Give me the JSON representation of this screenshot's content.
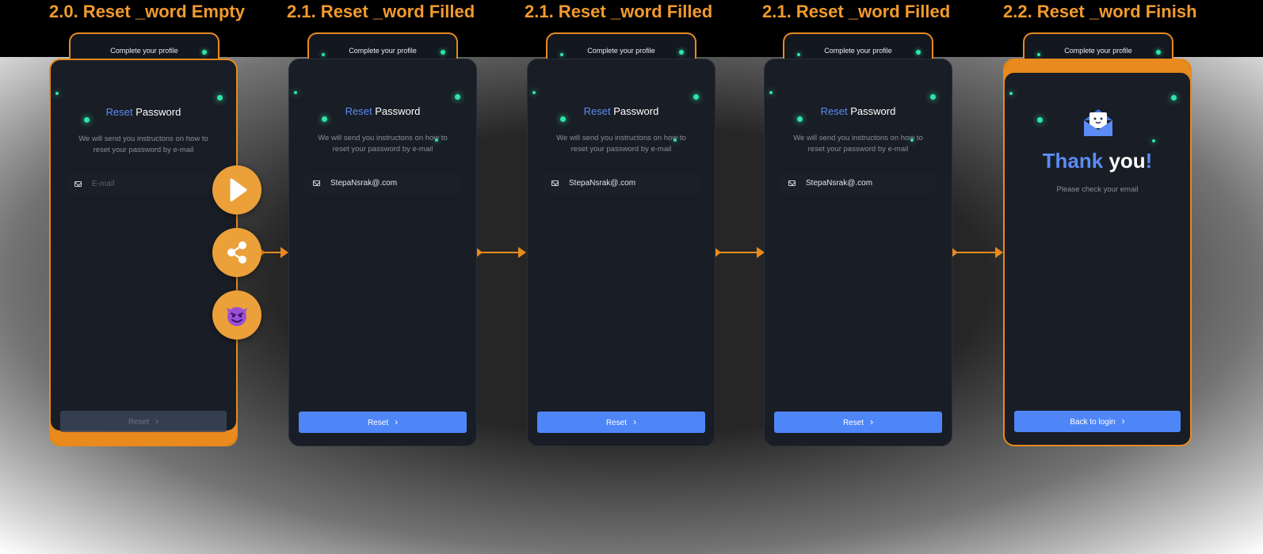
{
  "frames": [
    {
      "title": "2.0. Reset _word Empty",
      "tab_label": "Complete your profile",
      "heading_accent": "Reset",
      "heading_rest": " Password",
      "description": "We will send you instructons on how to reset your password by e-mail",
      "email_placeholder": "E-mail",
      "email_value": "",
      "button_label": "Reset"
    },
    {
      "title": "2.1. Reset _word Filled",
      "tab_label": "Complete your profile",
      "heading_accent": "Reset",
      "heading_rest": " Password",
      "description": "We will send you instructons on how to reset your password by e-mail",
      "email_value": "StepaNsrak@.com",
      "button_label": "Reset"
    },
    {
      "title": "2.1. Reset _word Filled",
      "tab_label": "Complete your profile",
      "heading_accent": "Reset",
      "heading_rest": " Password",
      "description": "We will send you instructons on how to reset your password by e-mail",
      "email_value": "StepaNsrak@.com",
      "button_label": "Reset"
    },
    {
      "title": "2.1. Reset _word Filled",
      "tab_label": "Complete your profile",
      "heading_accent": "Reset",
      "heading_rest": " Password",
      "description": "We will send you instructons on how to reset your password by e-mail",
      "email_value": "StepaNsrak@.com",
      "button_label": "Reset"
    },
    {
      "title": "2.2. Reset _word Finish",
      "tab_label": "Complete your profile",
      "thanks_accent": "Thank",
      "thanks_white": " you",
      "thanks_excl": "!",
      "check_email": "Please check your email",
      "button_label": "Back to login"
    }
  ],
  "fab": {
    "play_icon": "play-icon",
    "share_icon": "share-icon",
    "devil_icon": "smiling-imp-emoji"
  },
  "colors": {
    "accent_orange": "#e88a1d",
    "primary_blue": "#4f86f7",
    "glow_green": "#2ee6a6",
    "screen_bg": "#191d25"
  }
}
